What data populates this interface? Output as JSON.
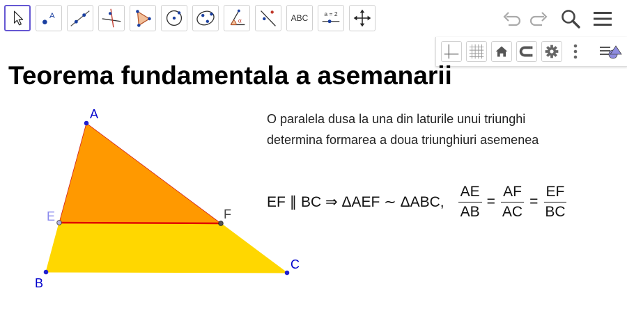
{
  "toolbar": {
    "tools": [
      {
        "name": "move-tool"
      },
      {
        "name": "point-tool",
        "label": "A"
      },
      {
        "name": "line-tool"
      },
      {
        "name": "perpendicular-line-tool"
      },
      {
        "name": "polygon-tool"
      },
      {
        "name": "circle-tool"
      },
      {
        "name": "ellipse-tool"
      },
      {
        "name": "angle-tool",
        "label": "α"
      },
      {
        "name": "reflect-tool"
      },
      {
        "name": "text-tool",
        "label": "ABC"
      },
      {
        "name": "slider-tool",
        "label": "a = 2"
      },
      {
        "name": "move-graphics-view-tool"
      }
    ],
    "right": [
      "undo-icon",
      "redo-icon",
      "search-icon",
      "menu-icon"
    ]
  },
  "stylebar": {
    "buttons": [
      "axes-icon",
      "grid-icon",
      "home-icon",
      "point-capturing-icon",
      "settings-icon",
      "more-icon",
      "style-bar-toggle-icon"
    ]
  },
  "colors": {
    "accent": "#6557d2",
    "triangle_top": "#ff9900",
    "trapezoid": "#ffd700",
    "segment_red": "#e00000",
    "point_blue": "#1f1fd0",
    "point_label_blue": "#0000cc",
    "point_e_label": "#8a8aee"
  },
  "page": {
    "title": "Teorema fundamentala a asemanarii",
    "description": [
      "O paralela dusa la una din laturile unui triunghi",
      "determina formarea a doua triunghiuri asemenea"
    ],
    "formula": {
      "lead": "EF ∥ BC ⇒ ΔAEF ∼ ΔABC,",
      "fractions": [
        {
          "num": "AE",
          "den": "AB"
        },
        {
          "num": "AF",
          "den": "AC"
        },
        {
          "num": "EF",
          "den": "BC"
        }
      ],
      "equals": "="
    }
  },
  "geometry": {
    "points": {
      "A": {
        "label": "A"
      },
      "B": {
        "label": "B"
      },
      "C": {
        "label": "C"
      },
      "E": {
        "label": "E"
      },
      "F": {
        "label": "F"
      }
    }
  }
}
